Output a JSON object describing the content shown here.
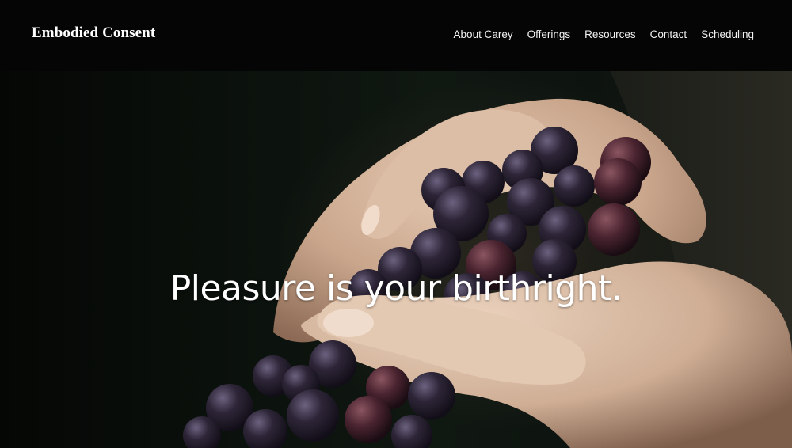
{
  "header": {
    "brand": "Embodied Consent",
    "nav": [
      {
        "label": "About Carey"
      },
      {
        "label": "Offerings"
      },
      {
        "label": "Resources"
      },
      {
        "label": "Contact"
      },
      {
        "label": "Scheduling"
      }
    ]
  },
  "hero": {
    "headline": "Pleasure is your birthright.",
    "image_subject": "hands-holding-grapes"
  },
  "colors": {
    "header_bg": "#050505",
    "text": "#ffffff",
    "grape": "#2a2436",
    "skin": "#d8b9a0"
  }
}
